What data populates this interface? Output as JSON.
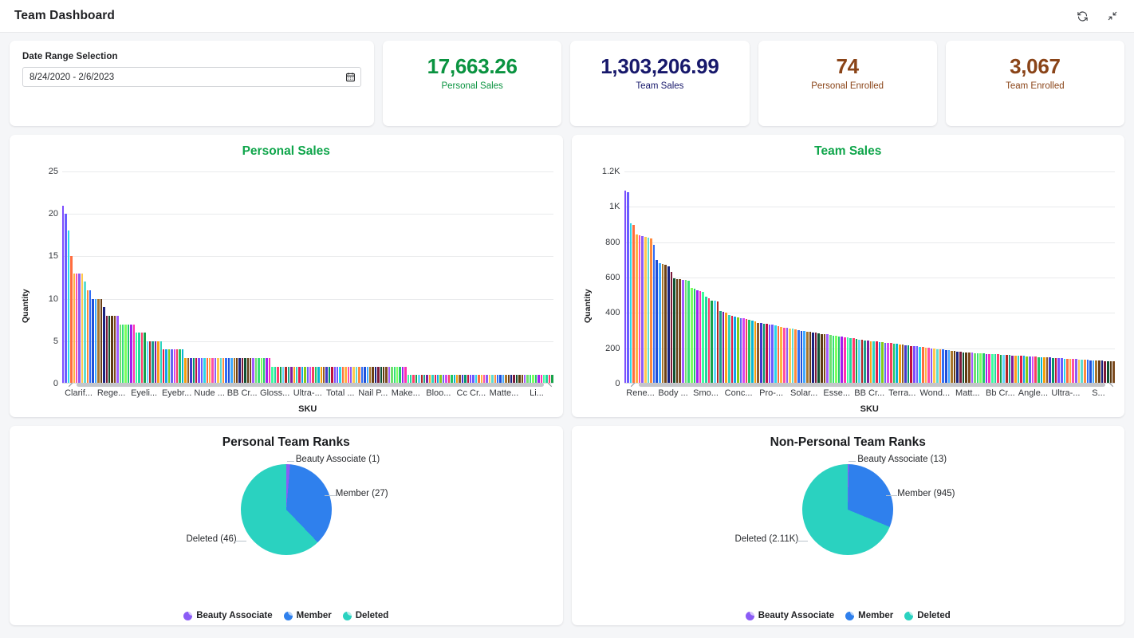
{
  "header": {
    "title": "Team Dashboard",
    "refresh_icon": "refresh-icon",
    "collapse_icon": "collapse-icon"
  },
  "date_filter": {
    "label": "Date Range Selection",
    "value": "8/24/2020 - 2/6/2023",
    "icon": "calendar-icon"
  },
  "kpis": [
    {
      "value": "17,663.26",
      "label": "Personal Sales",
      "color": "#0a9340"
    },
    {
      "value": "1,303,206.99",
      "label": "Team Sales",
      "color": "#17186b"
    },
    {
      "value": "74",
      "label": "Personal Enrolled",
      "color": "#8a4418"
    },
    {
      "value": "3,067",
      "label": "Team Enrolled",
      "color": "#8a4418"
    }
  ],
  "chart_data": [
    {
      "type": "bar",
      "title": "Personal Sales",
      "title_color": "#0ea54a",
      "xlabel": "SKU",
      "ylabel": "Quantity",
      "ylim": [
        0,
        25
      ],
      "yticks": [
        "0",
        "5",
        "10",
        "15",
        "20",
        "25"
      ],
      "grid": true,
      "xtick_labels": [
        "Clarif...",
        "Rege...",
        "Eyeli...",
        "Eyebr...",
        "Nude ...",
        "BB Cr...",
        "Gloss...",
        "Ultra-...",
        "Total ...",
        "Nail P...",
        "Make...",
        "Bloo...",
        "Cc Cr...",
        "Matte...",
        "Li..."
      ],
      "values": [
        21,
        20,
        18,
        15,
        13,
        13,
        13,
        13,
        12,
        11,
        11,
        10,
        10,
        10,
        10,
        9,
        8,
        8,
        8,
        8,
        8,
        7,
        7,
        7,
        7,
        7,
        7,
        6,
        6,
        6,
        6,
        5,
        5,
        5,
        5,
        5,
        5,
        4,
        4,
        4,
        4,
        4,
        4,
        4,
        4,
        3,
        3,
        3,
        3,
        3,
        3,
        3,
        3,
        3,
        3,
        3,
        3,
        3,
        3,
        3,
        3,
        3,
        3,
        3,
        3,
        3,
        3,
        3,
        3,
        3,
        3,
        3,
        3,
        3,
        3,
        3,
        3,
        2,
        2,
        2,
        2,
        2,
        2,
        2,
        2,
        2,
        2,
        2,
        2,
        2,
        2,
        2,
        2,
        2,
        2,
        2,
        2,
        2,
        2,
        2,
        2,
        2,
        2,
        2,
        2,
        2,
        2,
        2,
        2,
        2,
        2,
        2,
        2,
        2,
        2,
        2,
        2,
        2,
        2,
        2,
        2,
        2,
        2,
        2,
        2,
        2,
        2,
        1,
        1,
        1,
        1,
        1,
        1,
        1,
        1,
        1,
        1,
        1,
        1,
        1,
        1,
        1,
        1,
        1,
        1,
        1,
        1,
        1,
        1,
        1,
        1,
        1,
        1,
        1,
        1,
        1,
        1,
        1,
        1,
        1,
        1,
        1,
        1,
        1,
        1,
        1,
        1,
        1,
        1,
        1,
        1,
        1,
        1,
        1,
        1,
        1,
        1,
        1,
        1,
        1,
        1
      ]
    },
    {
      "type": "bar",
      "title": "Team Sales",
      "title_color": "#0ea54a",
      "xlabel": "SKU",
      "ylabel": "Quantity",
      "ylim": [
        0,
        1200
      ],
      "yticks": [
        "0",
        "200",
        "400",
        "600",
        "800",
        "1K",
        "1.2K"
      ],
      "grid": true,
      "xtick_labels": [
        "Rene...",
        "Body ...",
        "Smo...",
        "Conc...",
        "Pro-...",
        "Solar...",
        "Esse...",
        "BB Cr...",
        "Terra...",
        "Wond...",
        "Matt...",
        "Bb Cr...",
        "Angle...",
        "Ultra-...",
        "S..."
      ],
      "values": [
        1090,
        1085,
        905,
        900,
        845,
        840,
        835,
        830,
        825,
        820,
        785,
        700,
        680,
        675,
        670,
        665,
        630,
        595,
        592,
        590,
        588,
        585,
        580,
        540,
        535,
        530,
        525,
        520,
        490,
        485,
        470,
        467,
        465,
        410,
        405,
        400,
        390,
        385,
        380,
        375,
        370,
        368,
        365,
        360,
        355,
        350,
        345,
        342,
        340,
        338,
        335,
        332,
        330,
        325,
        322,
        318,
        315,
        312,
        310,
        305,
        302,
        300,
        298,
        295,
        292,
        290,
        288,
        285,
        282,
        280,
        278,
        275,
        272,
        270,
        268,
        265,
        262,
        260,
        258,
        255,
        252,
        250,
        248,
        245,
        242,
        240,
        240,
        238,
        236,
        234,
        232,
        230,
        228,
        226,
        224,
        222,
        220,
        218,
        216,
        214,
        212,
        210,
        208,
        206,
        204,
        202,
        200,
        198,
        196,
        194,
        192,
        190,
        188,
        186,
        184,
        182,
        180,
        178,
        176,
        175,
        174,
        173,
        172,
        171,
        170,
        169,
        168,
        167,
        166,
        165,
        164,
        163,
        162,
        161,
        160,
        159,
        158,
        157,
        156,
        155,
        154,
        153,
        152,
        151,
        150,
        149,
        148,
        147,
        146,
        145,
        144,
        143,
        142,
        141,
        140,
        139,
        138,
        137,
        136,
        135,
        134,
        133,
        132,
        131,
        130,
        129,
        128,
        127,
        126,
        125
      ]
    },
    {
      "type": "pie",
      "title": "Personal Team Ranks",
      "title_color": "#1a1c1f",
      "labels": [
        "Beauty Associate",
        "Member",
        "Deleted"
      ],
      "values": [
        1,
        27,
        46
      ],
      "value_labels": [
        "Beauty Associate (1)",
        "Member (27)",
        "Deleted (46)"
      ],
      "colors": [
        "#8b5cf6",
        "#2f80ed",
        "#2ad2c0"
      ],
      "legend_position": "bottom"
    },
    {
      "type": "pie",
      "title": "Non-Personal Team Ranks",
      "title_color": "#1a1c1f",
      "labels": [
        "Beauty Associate",
        "Member",
        "Deleted"
      ],
      "values": [
        13,
        945,
        2110
      ],
      "value_labels": [
        "Beauty Associate (13)",
        "Member (945)",
        "Deleted (2.11K)"
      ],
      "colors": [
        "#8b5cf6",
        "#2f80ed",
        "#2ad2c0"
      ],
      "legend_position": "bottom"
    }
  ],
  "bar_palette": [
    "#7c4dff",
    "#6a5cff",
    "#29d6e8",
    "#ff6d3f",
    "#ffb340",
    "#ff4fa3",
    "#8b5cf6",
    "#ffc94d",
    "#5ddcd2",
    "#ff8a3d",
    "#2f6df6",
    "#1f4fd8",
    "#3fa9ff",
    "#a8762b",
    "#6b3f14",
    "#1a237e",
    "#7b1a3a",
    "#0f5132",
    "#5d3a12",
    "#7c4a1e",
    "#a259ff",
    "#6ee06e",
    "#34e07a",
    "#7cff5e",
    "#1fc96b",
    "#a020f0",
    "#ff2fb0",
    "#3cff9e",
    "#20d7a0",
    "#ff3b6b",
    "#16a34a",
    "#65d6ff",
    "#b32424",
    "#1e9e8a",
    "#7f1d9e",
    "#ff9f1c",
    "#2dd4bf",
    "#e11d48",
    "#0ea5e9",
    "#84cc16",
    "#6366f1",
    "#d946ef",
    "#f43f5e",
    "#22c55e",
    "#06b6d4",
    "#f59e0b",
    "#8b5a2b",
    "#4338ca",
    "#059669",
    "#be123c"
  ]
}
